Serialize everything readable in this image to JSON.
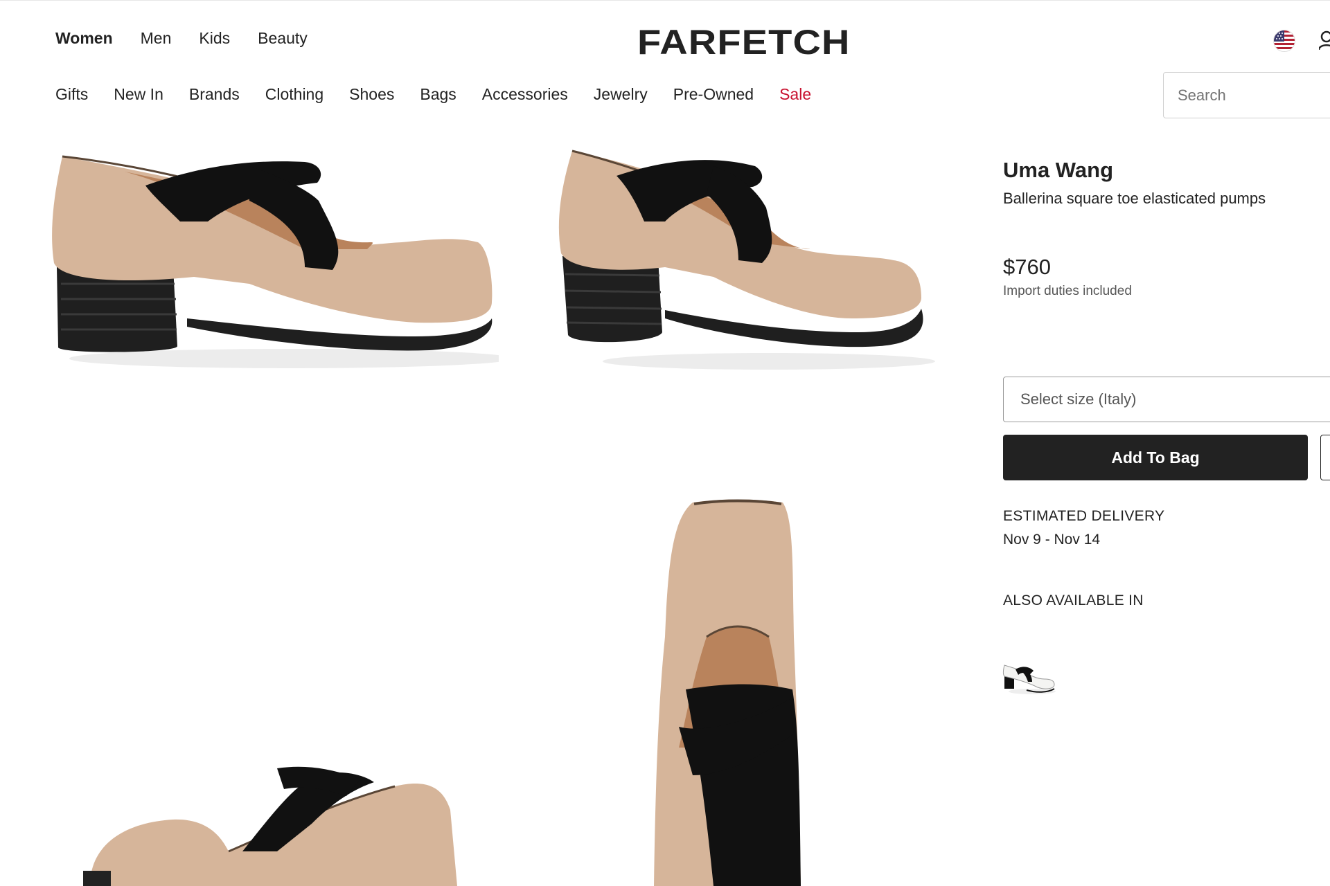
{
  "header": {
    "gender_nav": [
      "Women",
      "Men",
      "Kids",
      "Beauty"
    ],
    "active_gender": "Women",
    "logo": "FARFETCH",
    "search_placeholder": "Search"
  },
  "categories": [
    "Gifts",
    "New In",
    "Brands",
    "Clothing",
    "Shoes",
    "Bags",
    "Accessories",
    "Jewelry",
    "Pre-Owned",
    "Sale"
  ],
  "product": {
    "brand": "Uma Wang",
    "description": "Ballerina square toe elasticated pumps",
    "price": "$760",
    "duties_note": "Import duties included",
    "size_placeholder": "Select size (Italy)",
    "add_to_bag": "Add To Bag",
    "delivery_label": "ESTIMATED DELIVERY",
    "delivery_dates": "Nov 9 - Nov 14",
    "also_available_label": "ALSO AVAILABLE IN"
  },
  "colors": {
    "sale": "#c8102e",
    "button_bg": "#222222",
    "leather": "#d6b59a",
    "strap": "#111111"
  },
  "icons": [
    "us-flag-icon",
    "account-icon",
    "heart-icon"
  ]
}
